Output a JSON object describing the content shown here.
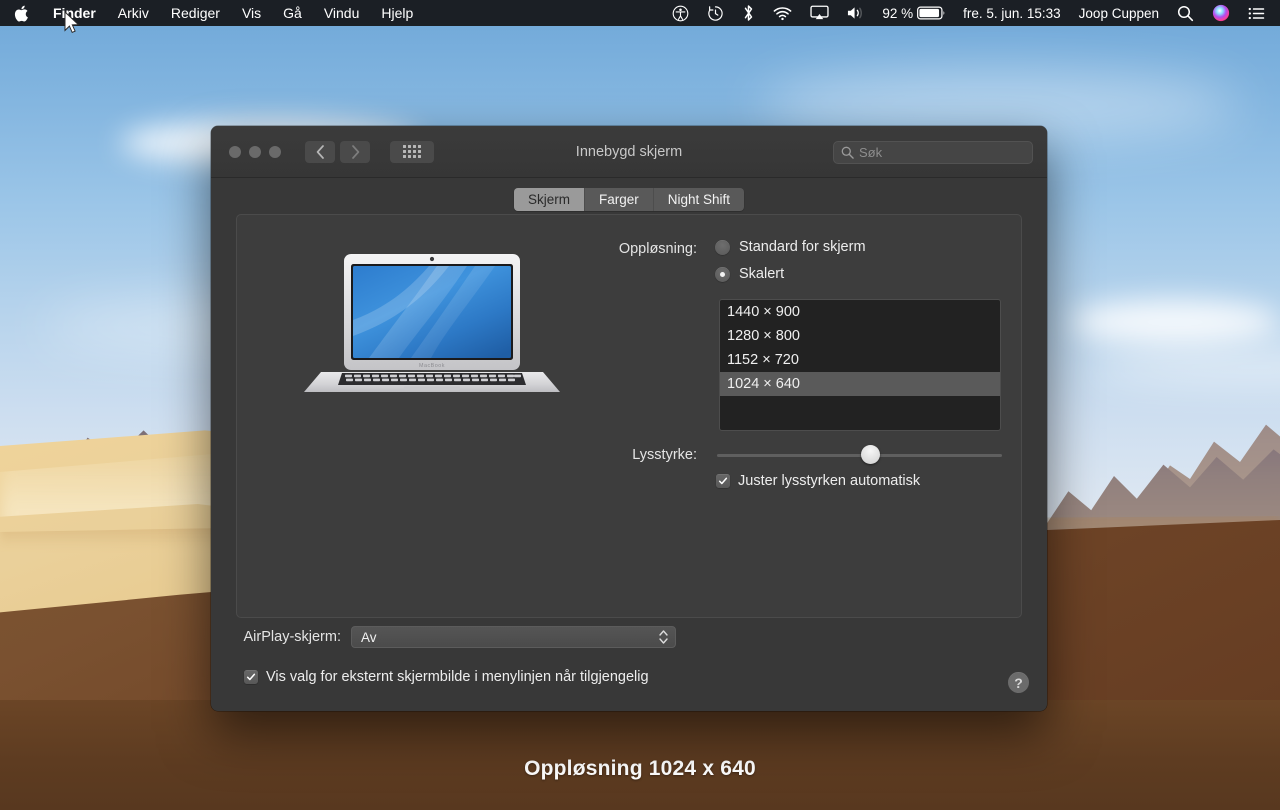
{
  "menubar": {
    "apple_icon": "apple-logo-icon",
    "app_name": "Finder",
    "items": [
      "Arkiv",
      "Rediger",
      "Vis",
      "Gå",
      "Vindu",
      "Hjelp"
    ],
    "status": {
      "accessibility_icon": "accessibility-icon",
      "timemachine_icon": "time-machine-icon",
      "bluetooth_icon": "bluetooth-icon",
      "wifi_icon": "wifi-icon",
      "airplay_icon": "airplay-screen-mirroring-icon",
      "volume_icon": "volume-icon",
      "battery_percent": "92 %",
      "battery_icon": "battery-icon",
      "datetime": "fre. 5. jun. 15:33",
      "user_name": "Joop Cuppen",
      "spotlight_icon": "search-icon",
      "siri_icon": "siri-icon",
      "control_center_icon": "notification-center-icon"
    }
  },
  "window": {
    "title": "Innebygd skjerm",
    "traffic_lights": [
      "close",
      "minimize",
      "zoom"
    ],
    "nav": {
      "back_icon": "chevron-left-icon",
      "forward_icon": "chevron-right-icon",
      "grid_icon": "show-all-grid-icon"
    },
    "search": {
      "placeholder": "Søk",
      "value": "",
      "icon": "search-icon"
    },
    "tabs": [
      {
        "label": "Skjerm",
        "active": true
      },
      {
        "label": "Farger",
        "active": false
      },
      {
        "label": "Night Shift",
        "active": false
      }
    ],
    "display_preview": {
      "device_icon": "macbook-illustration",
      "brand_text": "MacBook"
    },
    "resolution": {
      "label": "Oppløsning:",
      "options": [
        {
          "label": "Standard for skjerm",
          "selected": false
        },
        {
          "label": "Skalert",
          "selected": true
        }
      ],
      "list": [
        {
          "label": "1440 × 900",
          "selected": false
        },
        {
          "label": "1280 × 800",
          "selected": false
        },
        {
          "label": "1152 × 720",
          "selected": false
        },
        {
          "label": "1024 × 640",
          "selected": true
        }
      ]
    },
    "brightness": {
      "label": "Lysstyrke:",
      "value_percent": 55,
      "auto_checkbox": {
        "label": "Juster lysstyrken automatisk",
        "checked": true
      }
    },
    "airplay": {
      "label": "AirPlay-skjerm:",
      "value": "Av",
      "options": [
        "Av"
      ],
      "stepper_icon": "stepper-updown-icon"
    },
    "menubar_option": {
      "label": "Vis valg for eksternt skjermbilde i menylinjen når tilgjengelig",
      "checked": true
    },
    "help_button": {
      "label": "?",
      "icon": "help-question-icon"
    }
  },
  "caption": {
    "text": "Oppløsning 1024 x 640"
  },
  "colors": {
    "window_bg": "#383838",
    "panel_bg": "#3d3d3d",
    "list_bg": "#222222",
    "selection": "#5a5a5a",
    "tab_active": "#9a9a9a",
    "menubar_bg": "#141416",
    "text": "#ededed",
    "caption_bg": "#5e3c21"
  }
}
